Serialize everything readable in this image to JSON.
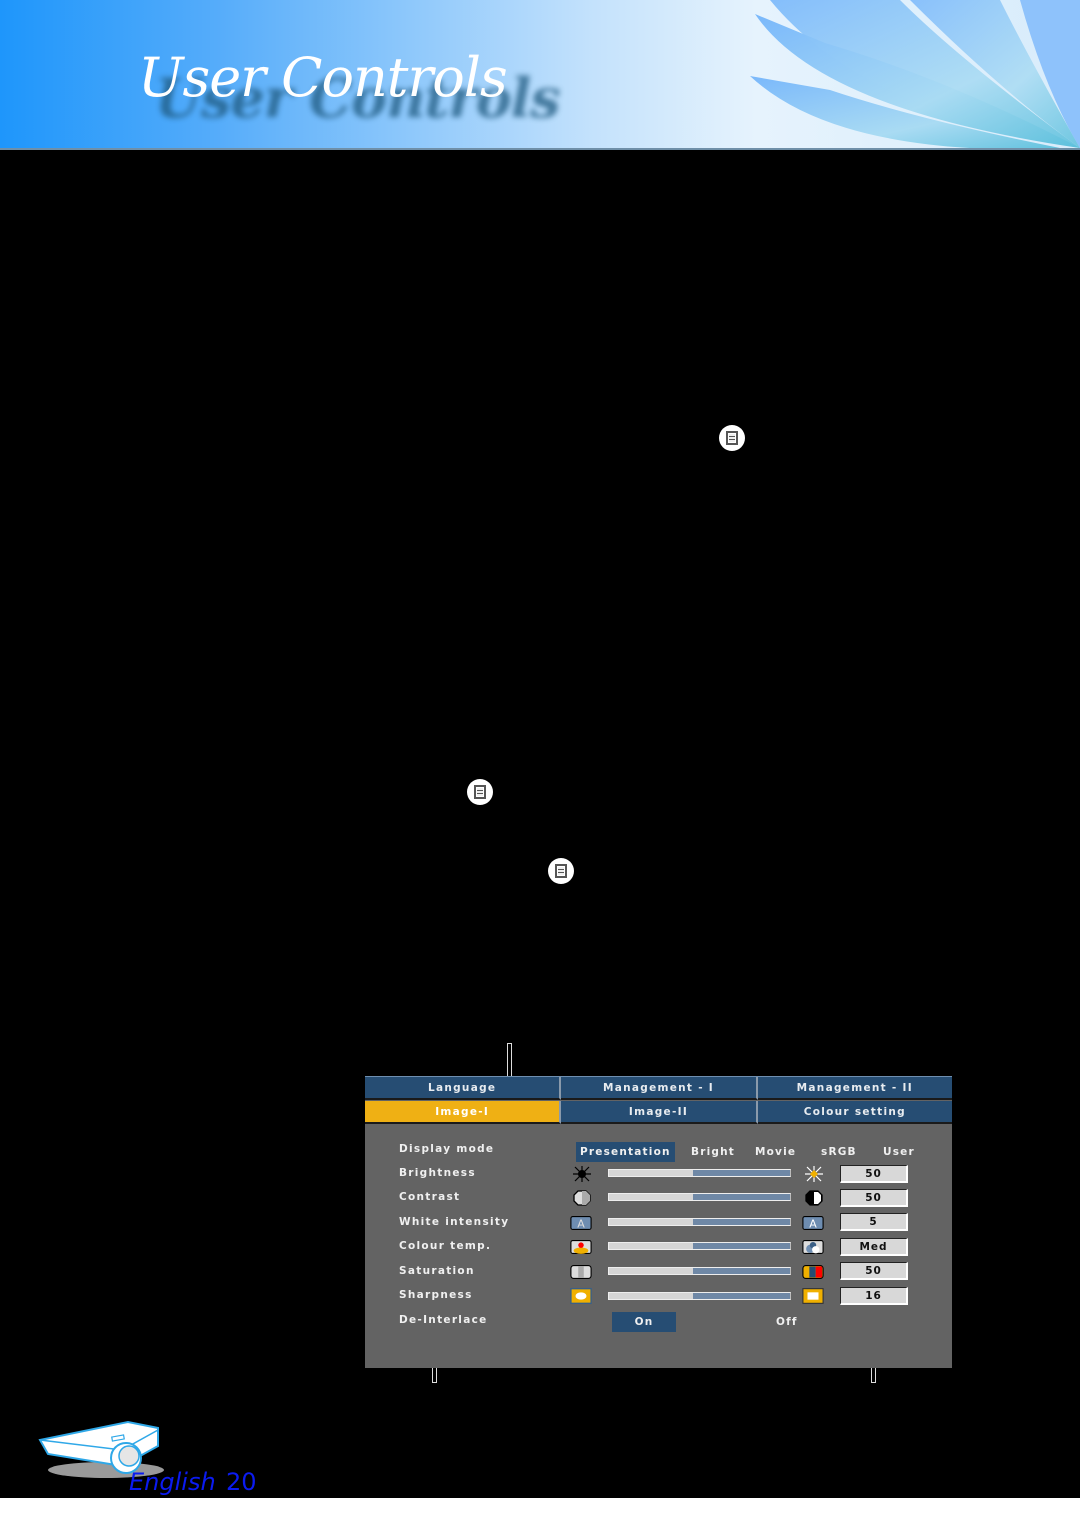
{
  "header": {
    "title": "User Controls"
  },
  "osd": {
    "tabs_row1": [
      {
        "label": "Language",
        "active": false
      },
      {
        "label": "Management - I",
        "active": false
      },
      {
        "label": "Management - II",
        "active": false
      }
    ],
    "tabs_row2": [
      {
        "label": "Image-I",
        "active": true
      },
      {
        "label": "Image-II",
        "active": false
      },
      {
        "label": "Colour setting",
        "active": false
      }
    ],
    "display_mode": {
      "label": "Display mode",
      "options": [
        "Presentation",
        "Bright",
        "Movie",
        "sRGB",
        "User"
      ],
      "selected": "Presentation"
    },
    "settings": [
      {
        "label": "Brightness",
        "value": "50",
        "level": 0.5,
        "left_icon": "brightness-low-icon",
        "right_icon": "brightness-high-icon"
      },
      {
        "label": "Contrast",
        "value": "50",
        "level": 0.5,
        "left_icon": "contrast-low-icon",
        "right_icon": "contrast-high-icon"
      },
      {
        "label": "White intensity",
        "value": "5",
        "level": 0.5,
        "left_icon": "white-intensity-low-icon",
        "right_icon": "white-intensity-high-icon"
      },
      {
        "label": "Colour temp.",
        "value": "Med",
        "level": 0.5,
        "left_icon": "colour-temp-warm-icon",
        "right_icon": "colour-temp-cool-icon"
      },
      {
        "label": "Saturation",
        "value": "50",
        "level": 0.5,
        "left_icon": "saturation-low-icon",
        "right_icon": "saturation-high-icon"
      },
      {
        "label": "Sharpness",
        "value": "16",
        "level": 0.5,
        "left_icon": "sharpness-low-icon",
        "right_icon": "sharpness-high-icon"
      }
    ],
    "deinterlace": {
      "label": "De-Interlace",
      "on_label": "On",
      "off_label": "Off",
      "selected": "On"
    }
  },
  "footer": {
    "language": "English",
    "page_number": "20"
  },
  "colors": {
    "tab_blue": "#264d73",
    "tab_active": "#efb014",
    "osd_bg": "#636363",
    "footer_text": "#0b1bf0"
  }
}
